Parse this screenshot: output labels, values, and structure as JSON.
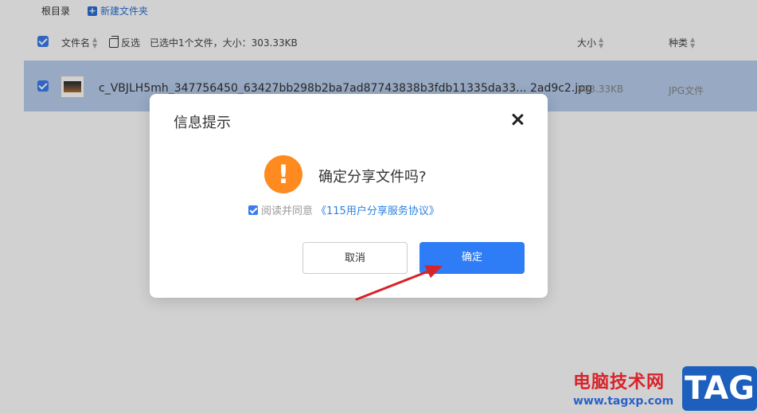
{
  "toolbar": {
    "root_label": "根目录",
    "new_folder_label": "新建文件夹"
  },
  "header": {
    "name_col": "文件名",
    "invert_label": "反选",
    "selection_info": "已选中1个文件，大小：303.33KB",
    "size_col": "大小",
    "type_col": "种类"
  },
  "file": {
    "name": "c_VBJLH5mh_347756450_63427bb298b2ba7ad87743838b3fdb11335da33... 2ad9c2.jpg",
    "size": "303.33KB",
    "type": "JPG文件"
  },
  "dialog": {
    "title": "信息提示",
    "message": "确定分享文件吗?",
    "agree_text": "阅读并同意",
    "agree_link": "《115用户分享服务协议》",
    "cancel_label": "取消",
    "ok_label": "确定",
    "warn_symbol": "!"
  },
  "watermark": {
    "text": "电脑技术网",
    "url": "www.tagxp.com",
    "tag": "TAG"
  },
  "colors": {
    "primary": "#2e7df6",
    "warning": "#ff8a1f",
    "row_selected": "#b9cfee",
    "arrow": "#d8232a"
  }
}
